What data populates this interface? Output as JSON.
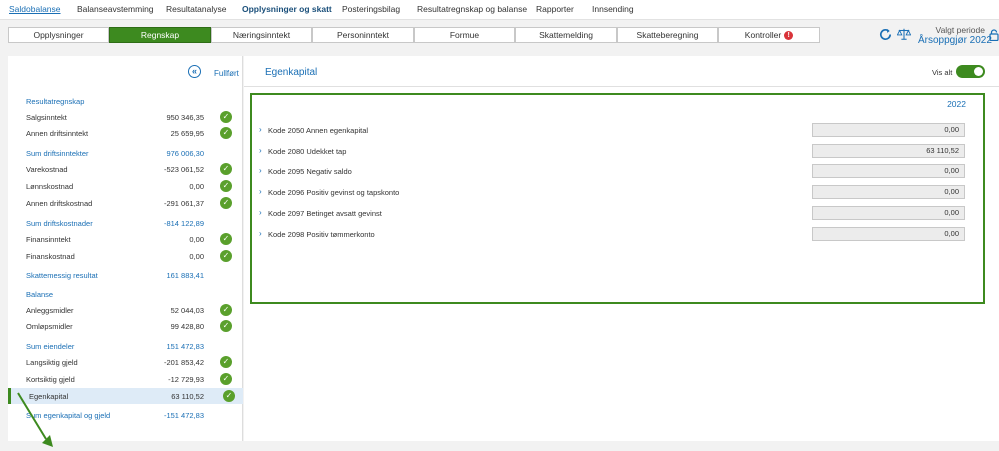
{
  "topnav": [
    "Saldobalanse",
    "Balanseavstemming",
    "Resultatanalyse",
    "Opplysninger og skatt",
    "Posteringsbilag",
    "Resultatregnskap og balanse",
    "Rapporter",
    "Innsending"
  ],
  "tabs": [
    "Opplysninger",
    "Regnskap",
    "Næringsinntekt",
    "Personinntekt",
    "Formue",
    "Skattemelding",
    "Skatteberegning",
    "Kontroller"
  ],
  "kontroller_badge": "!",
  "period": {
    "label": "Valgt periode",
    "value": "Årsoppgjør 2022"
  },
  "left": {
    "fullfort_label": "Fullført",
    "collapse_icon": "«",
    "rows": [
      {
        "label": "Resultatregnskap",
        "value": "",
        "kind": "section",
        "check": false
      },
      {
        "label": "Salgsinntekt",
        "value": "950 346,35",
        "kind": "item",
        "check": true
      },
      {
        "label": "Annen driftsinntekt",
        "value": "25 659,95",
        "kind": "item",
        "check": true
      },
      {
        "label": "Sum driftsinntekter",
        "value": "976 006,30",
        "kind": "sum",
        "check": false
      },
      {
        "label": "Varekostnad",
        "value": "-523 061,52",
        "kind": "item",
        "check": true
      },
      {
        "label": "Lønnskostnad",
        "value": "0,00",
        "kind": "item",
        "check": true
      },
      {
        "label": "Annen driftskostnad",
        "value": "-291 061,37",
        "kind": "item",
        "check": true
      },
      {
        "label": "Sum driftskostnader",
        "value": "-814 122,89",
        "kind": "sum",
        "check": false
      },
      {
        "label": "Finansinntekt",
        "value": "0,00",
        "kind": "item",
        "check": true
      },
      {
        "label": "Finanskostnad",
        "value": "0,00",
        "kind": "item",
        "check": true
      },
      {
        "label": "Skattemessig resultat",
        "value": "161 883,41",
        "kind": "sum",
        "check": false
      },
      {
        "label": "Balanse",
        "value": "",
        "kind": "section",
        "check": false
      },
      {
        "label": "Anleggsmidler",
        "value": "52 044,03",
        "kind": "item",
        "check": true
      },
      {
        "label": "Omløpsmidler",
        "value": "99 428,80",
        "kind": "item",
        "check": true
      },
      {
        "label": "Sum eiendeler",
        "value": "151 472,83",
        "kind": "sum",
        "check": false
      },
      {
        "label": "Langsiktig gjeld",
        "value": "-201 853,42",
        "kind": "item",
        "check": true
      },
      {
        "label": "Kortsiktig gjeld",
        "value": "-12 729,93",
        "kind": "item",
        "check": true
      },
      {
        "label": "Egenkapital",
        "value": "63 110,52",
        "kind": "selected",
        "check": true
      },
      {
        "label": "Sum egenkapital og gjeld",
        "value": "-151 472,83",
        "kind": "sum",
        "check": false
      }
    ]
  },
  "right": {
    "title": "Egenkapital",
    "vis_alt_label": "Vis alt",
    "vis_alt_on": true,
    "year": "2022",
    "rows": [
      {
        "label": "Kode 2050 Annen egenkapital",
        "value": "0,00"
      },
      {
        "label": "Kode 2080 Udekket tap",
        "value": "63 110,52"
      },
      {
        "label": "Kode 2095 Negativ saldo",
        "value": "0,00"
      },
      {
        "label": "Kode 2096 Positiv gevinst og tapskonto",
        "value": "0,00"
      },
      {
        "label": "Kode 2097 Betinget avsatt gevinst",
        "value": "0,00"
      },
      {
        "label": "Kode 2098 Positiv tømmerkonto",
        "value": "0,00"
      }
    ]
  },
  "colors": {
    "accent_green": "#3d8a1f",
    "link_blue": "#1a6fb5",
    "alert_red": "#d9343a"
  }
}
